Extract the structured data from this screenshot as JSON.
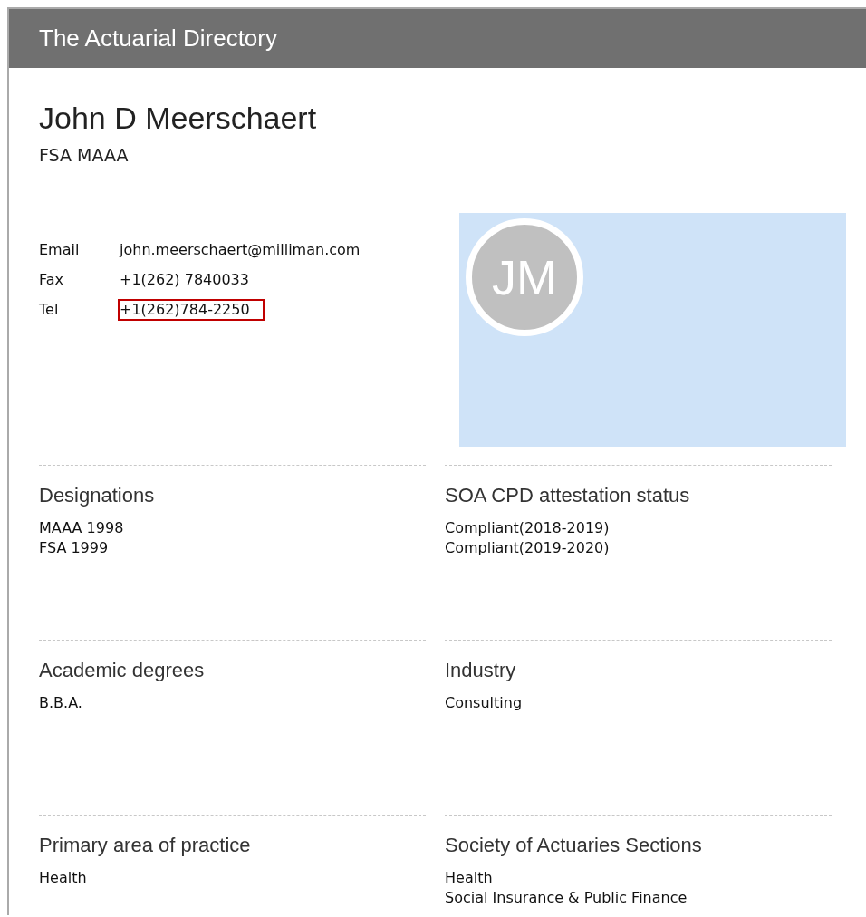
{
  "header": {
    "title": "The Actuarial Directory"
  },
  "profile": {
    "name": "John D Meerschaert",
    "credentials": "FSA MAAA",
    "initials": "JM"
  },
  "contacts": [
    {
      "label": "Email",
      "value": "john.meerschaert@milliman.com",
      "highlighted": false
    },
    {
      "label": "Fax",
      "value": "+1(262) 7840033",
      "highlighted": false
    },
    {
      "label": "Tel",
      "value": "+1(262)784-2250",
      "highlighted": true
    }
  ],
  "sections": [
    {
      "heading": "Designations",
      "items": [
        "MAAA 1998",
        "FSA 1999"
      ]
    },
    {
      "heading": "SOA CPD attestation status",
      "items": [
        "Compliant(2018-2019)",
        "Compliant(2019-2020)"
      ]
    },
    {
      "heading": "Academic degrees",
      "items": [
        "B.B.A."
      ]
    },
    {
      "heading": "Industry",
      "items": [
        "Consulting"
      ]
    },
    {
      "heading": "Primary area of practice",
      "items": [
        "Health"
      ]
    },
    {
      "heading": "Society of Actuaries Sections",
      "items": [
        "Health",
        "Social Insurance & Public Finance"
      ]
    }
  ]
}
